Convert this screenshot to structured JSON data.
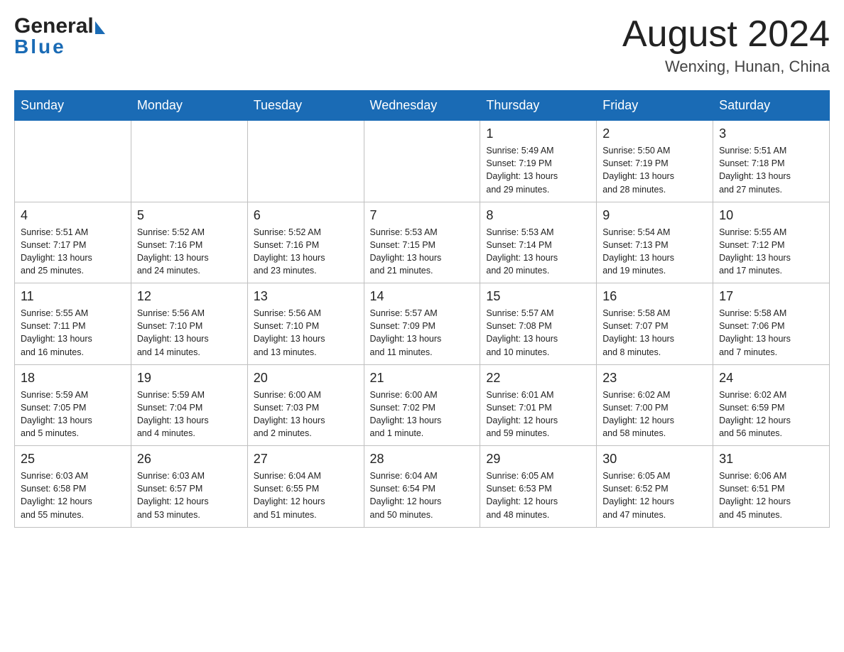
{
  "header": {
    "logo_general": "General",
    "logo_blue": "Blue",
    "title": "August 2024",
    "location": "Wenxing, Hunan, China"
  },
  "days_of_week": [
    "Sunday",
    "Monday",
    "Tuesday",
    "Wednesday",
    "Thursday",
    "Friday",
    "Saturday"
  ],
  "weeks": [
    [
      {
        "day": "",
        "info": ""
      },
      {
        "day": "",
        "info": ""
      },
      {
        "day": "",
        "info": ""
      },
      {
        "day": "",
        "info": ""
      },
      {
        "day": "1",
        "info": "Sunrise: 5:49 AM\nSunset: 7:19 PM\nDaylight: 13 hours\nand 29 minutes."
      },
      {
        "day": "2",
        "info": "Sunrise: 5:50 AM\nSunset: 7:19 PM\nDaylight: 13 hours\nand 28 minutes."
      },
      {
        "day": "3",
        "info": "Sunrise: 5:51 AM\nSunset: 7:18 PM\nDaylight: 13 hours\nand 27 minutes."
      }
    ],
    [
      {
        "day": "4",
        "info": "Sunrise: 5:51 AM\nSunset: 7:17 PM\nDaylight: 13 hours\nand 25 minutes."
      },
      {
        "day": "5",
        "info": "Sunrise: 5:52 AM\nSunset: 7:16 PM\nDaylight: 13 hours\nand 24 minutes."
      },
      {
        "day": "6",
        "info": "Sunrise: 5:52 AM\nSunset: 7:16 PM\nDaylight: 13 hours\nand 23 minutes."
      },
      {
        "day": "7",
        "info": "Sunrise: 5:53 AM\nSunset: 7:15 PM\nDaylight: 13 hours\nand 21 minutes."
      },
      {
        "day": "8",
        "info": "Sunrise: 5:53 AM\nSunset: 7:14 PM\nDaylight: 13 hours\nand 20 minutes."
      },
      {
        "day": "9",
        "info": "Sunrise: 5:54 AM\nSunset: 7:13 PM\nDaylight: 13 hours\nand 19 minutes."
      },
      {
        "day": "10",
        "info": "Sunrise: 5:55 AM\nSunset: 7:12 PM\nDaylight: 13 hours\nand 17 minutes."
      }
    ],
    [
      {
        "day": "11",
        "info": "Sunrise: 5:55 AM\nSunset: 7:11 PM\nDaylight: 13 hours\nand 16 minutes."
      },
      {
        "day": "12",
        "info": "Sunrise: 5:56 AM\nSunset: 7:10 PM\nDaylight: 13 hours\nand 14 minutes."
      },
      {
        "day": "13",
        "info": "Sunrise: 5:56 AM\nSunset: 7:10 PM\nDaylight: 13 hours\nand 13 minutes."
      },
      {
        "day": "14",
        "info": "Sunrise: 5:57 AM\nSunset: 7:09 PM\nDaylight: 13 hours\nand 11 minutes."
      },
      {
        "day": "15",
        "info": "Sunrise: 5:57 AM\nSunset: 7:08 PM\nDaylight: 13 hours\nand 10 minutes."
      },
      {
        "day": "16",
        "info": "Sunrise: 5:58 AM\nSunset: 7:07 PM\nDaylight: 13 hours\nand 8 minutes."
      },
      {
        "day": "17",
        "info": "Sunrise: 5:58 AM\nSunset: 7:06 PM\nDaylight: 13 hours\nand 7 minutes."
      }
    ],
    [
      {
        "day": "18",
        "info": "Sunrise: 5:59 AM\nSunset: 7:05 PM\nDaylight: 13 hours\nand 5 minutes."
      },
      {
        "day": "19",
        "info": "Sunrise: 5:59 AM\nSunset: 7:04 PM\nDaylight: 13 hours\nand 4 minutes."
      },
      {
        "day": "20",
        "info": "Sunrise: 6:00 AM\nSunset: 7:03 PM\nDaylight: 13 hours\nand 2 minutes."
      },
      {
        "day": "21",
        "info": "Sunrise: 6:00 AM\nSunset: 7:02 PM\nDaylight: 13 hours\nand 1 minute."
      },
      {
        "day": "22",
        "info": "Sunrise: 6:01 AM\nSunset: 7:01 PM\nDaylight: 12 hours\nand 59 minutes."
      },
      {
        "day": "23",
        "info": "Sunrise: 6:02 AM\nSunset: 7:00 PM\nDaylight: 12 hours\nand 58 minutes."
      },
      {
        "day": "24",
        "info": "Sunrise: 6:02 AM\nSunset: 6:59 PM\nDaylight: 12 hours\nand 56 minutes."
      }
    ],
    [
      {
        "day": "25",
        "info": "Sunrise: 6:03 AM\nSunset: 6:58 PM\nDaylight: 12 hours\nand 55 minutes."
      },
      {
        "day": "26",
        "info": "Sunrise: 6:03 AM\nSunset: 6:57 PM\nDaylight: 12 hours\nand 53 minutes."
      },
      {
        "day": "27",
        "info": "Sunrise: 6:04 AM\nSunset: 6:55 PM\nDaylight: 12 hours\nand 51 minutes."
      },
      {
        "day": "28",
        "info": "Sunrise: 6:04 AM\nSunset: 6:54 PM\nDaylight: 12 hours\nand 50 minutes."
      },
      {
        "day": "29",
        "info": "Sunrise: 6:05 AM\nSunset: 6:53 PM\nDaylight: 12 hours\nand 48 minutes."
      },
      {
        "day": "30",
        "info": "Sunrise: 6:05 AM\nSunset: 6:52 PM\nDaylight: 12 hours\nand 47 minutes."
      },
      {
        "day": "31",
        "info": "Sunrise: 6:06 AM\nSunset: 6:51 PM\nDaylight: 12 hours\nand 45 minutes."
      }
    ]
  ]
}
